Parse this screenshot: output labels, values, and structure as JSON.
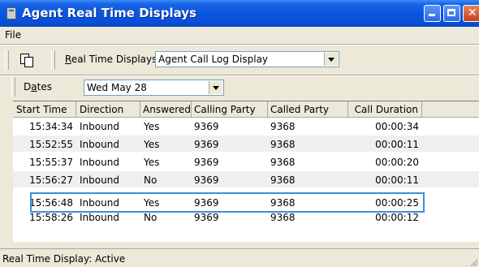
{
  "window": {
    "title": "Agent Real Time Displays",
    "title_icon": "application-icon",
    "controls": [
      "minimize-icon",
      "maximize-icon",
      "close-icon"
    ]
  },
  "menu": {
    "file": "File"
  },
  "toolbar": {
    "copy_icon": "copy-icon",
    "real_time_displays_prefix": "R",
    "real_time_displays_rest": "eal Time Displays",
    "display_select": "Agent Call Log Display"
  },
  "dates": {
    "label_prefix": "D",
    "label_underlined": "a",
    "label_rest": "tes",
    "select_value": "Wed May 28"
  },
  "table": {
    "columns": [
      "Start Time",
      "Direction",
      "Answered",
      "Calling Party",
      "Called Party",
      "Call Duration"
    ],
    "rows": [
      [
        "15:34:34",
        "Inbound",
        "Yes",
        "9369",
        "9368",
        "00:00:34"
      ],
      [
        "15:52:55",
        "Inbound",
        "Yes",
        "9369",
        "9368",
        "00:00:11"
      ],
      [
        "15:55:37",
        "Inbound",
        "Yes",
        "9369",
        "9368",
        "00:00:20"
      ],
      [
        "15:56:27",
        "Inbound",
        "No",
        "9369",
        "9368",
        "00:00:11"
      ],
      [
        "15:56:48",
        "Inbound",
        "Yes",
        "9369",
        "9368",
        "00:00:25"
      ],
      [
        "15:58:26",
        "Inbound",
        "No",
        "9369",
        "9368",
        "00:00:12"
      ]
    ],
    "highlighted_row": 4,
    "highlight_color": "#3b8ee0"
  },
  "status": {
    "text": "Real Time Display: Active"
  },
  "colors": {
    "title_bar": "#0a4fd6",
    "chrome": "#ece9d8"
  }
}
